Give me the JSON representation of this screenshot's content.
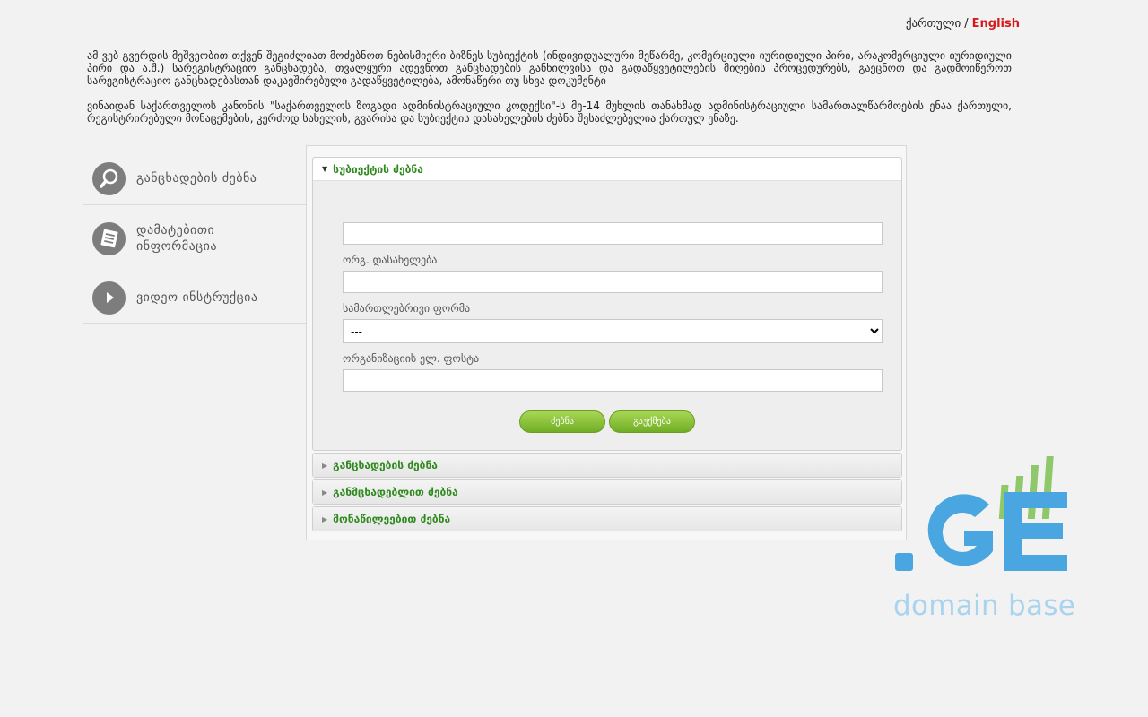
{
  "language": {
    "georgian": "ქართული",
    "separator": "/",
    "english": "English"
  },
  "intro": {
    "paragraph1": "ამ ვებ გვერდის მეშვეობით თქვენ შეგიძლიათ მოძებნოთ ნებისმიერი ბიზნეს სუბიექტის (ინდივიდუალური მეწარმე, კომერციული იურიდიული პირი, არაკომერციული იურიდიული პირი და ა.შ.) სარეგისტრაციო განცხადება, თვალყური ადევნოთ განცხადების განხილვისა და გადაწყვეტილების მიღების პროცედურებს, გაეცნოთ და გადმოიწეროთ სარეგისტრაციო განცხადებასთან დაკავშირებული გადაწყვეტილება, ამონაწერი თუ სხვა დოკუმენტი",
    "paragraph2": "ვინაიდან საქართველოს კანონის \"საქართველოს ზოგადი ადმინისტრაციული კოდექსი\"-ს მე-14 მუხლის თანახმად ადმინისტრაციული სამართალწარმოების ენაა ქართული, რეგისტრირებული მონაცემების, კერძოდ სახელის, გვარისა და სუბიექტის დასახელების ძებნა შესაძლებელია ქართულ ენაზე."
  },
  "left_menu": {
    "items": [
      {
        "label": "განცხადების ძებნა",
        "icon": "search-icon"
      },
      {
        "label_line1": "დამატებითი",
        "label_line2": "ინფორმაცია",
        "icon": "document-icon"
      },
      {
        "label": "ვიდეო ინსტრუქცია",
        "icon": "play-icon"
      }
    ]
  },
  "accordion": {
    "subject_search": {
      "title": "სუბიექტის ძებნა",
      "fields": {
        "first_input_value": "",
        "org_name_label": "ორგ. დასახელება",
        "org_name_value": "",
        "legal_form_label": "სამართლებრივი ფორმა",
        "legal_form_selected": "---",
        "email_label": "ორგანიზაციის ელ. ფოსტა",
        "email_value": ""
      },
      "search_button": "ძებნა",
      "cancel_button": "გაუქმება"
    },
    "application_search": {
      "title": "განცხადების ძებნა"
    },
    "applicant_search": {
      "title": "განმცხადებლით ძებნა"
    },
    "participant_search": {
      "title": "მონაწილეებით ძებნა"
    }
  },
  "logo": {
    "text": "domain base",
    "colors": {
      "main": "#4aa6e0",
      "bars": "#8ec86a",
      "text": "#a9d4ef"
    }
  }
}
